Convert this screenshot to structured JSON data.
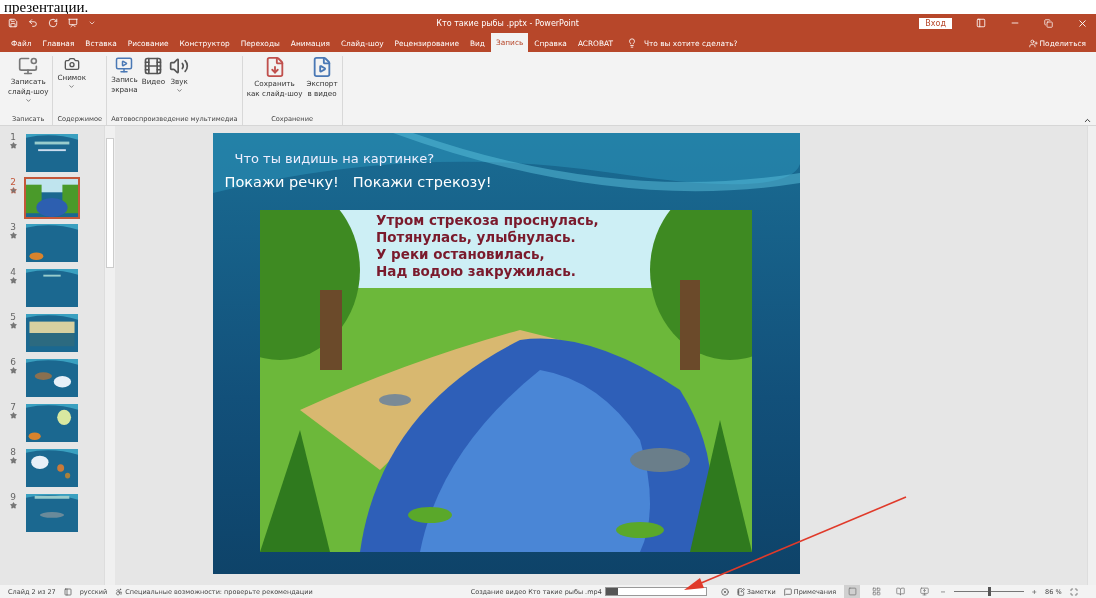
{
  "document_text": "презентации.",
  "window": {
    "title": "Кто такие  рыбы .pptx  -  PowerPoint",
    "sign_in": "Вход"
  },
  "tabs": [
    {
      "label": "Файл",
      "selected": false
    },
    {
      "label": "Главная",
      "selected": false
    },
    {
      "label": "Вставка",
      "selected": false
    },
    {
      "label": "Рисование",
      "selected": false
    },
    {
      "label": "Конструктор",
      "selected": false
    },
    {
      "label": "Переходы",
      "selected": false
    },
    {
      "label": "Анимация",
      "selected": false
    },
    {
      "label": "Слайд-шоу",
      "selected": false
    },
    {
      "label": "Рецензирование",
      "selected": false
    },
    {
      "label": "Вид",
      "selected": false
    },
    {
      "label": "Запись",
      "selected": true
    },
    {
      "label": "Справка",
      "selected": false
    },
    {
      "label": "ACROBAT",
      "selected": false
    }
  ],
  "tell_me": "Что вы хотите сделать?",
  "share": "Поделиться",
  "ribbon_groups": [
    {
      "label": "Записать",
      "buttons": [
        {
          "kind": "record",
          "lines": [
            "Записать",
            "слайд-шоу"
          ],
          "dropdown": true
        }
      ]
    },
    {
      "label": "Содержимое",
      "buttons": [
        {
          "kind": "camera",
          "lines": [
            "Снимок"
          ],
          "dropdown": true
        }
      ]
    },
    {
      "label": "Автовоспроизведение мультимедиа",
      "buttons": [
        {
          "kind": "screen",
          "lines": [
            "Запись",
            "экрана"
          ],
          "dropdown": false
        },
        {
          "kind": "video",
          "lines": [
            "Видео"
          ],
          "dropdown": false
        },
        {
          "kind": "sound",
          "lines": [
            "Звук"
          ],
          "dropdown": true
        }
      ]
    },
    {
      "label": "Сохранение",
      "buttons": [
        {
          "kind": "save",
          "lines": [
            "Сохранить",
            "как слайд-шоу"
          ],
          "dropdown": false
        },
        {
          "kind": "export",
          "lines": [
            "Экспорт",
            "в видео"
          ],
          "dropdown": false
        }
      ]
    }
  ],
  "slides": [
    {
      "number": "1",
      "selected": false
    },
    {
      "number": "2",
      "selected": true
    },
    {
      "number": "3",
      "selected": false
    },
    {
      "number": "4",
      "selected": false
    },
    {
      "number": "5",
      "selected": false
    },
    {
      "number": "6",
      "selected": false
    },
    {
      "number": "7",
      "selected": false
    },
    {
      "number": "8",
      "selected": false
    },
    {
      "number": "9",
      "selected": false
    }
  ],
  "slide": {
    "question": "Что ты видишь на картинке?",
    "prompts": [
      "Покажи речку!",
      "Покажи стрекозу!"
    ],
    "poem": [
      "Утром стрекоза проснулась,",
      "Потянулась, улыбнулась.",
      "У реки остановилась,",
      "Над водою  закружилась."
    ]
  },
  "status_bar": {
    "slide_info": "Слайд 2 из 27",
    "language": "русский",
    "accessibility": "Специальные возможности: проверьте рекомендации",
    "video_export": "Создание видео Кто такие  рыбы .mp4",
    "progress": {
      "level": 0.12
    },
    "notes": "Заметки",
    "comments": "Примечания",
    "views": [
      {
        "kind": "normal",
        "selected": true
      },
      {
        "kind": "sorter",
        "selected": false
      },
      {
        "kind": "reading",
        "selected": false
      },
      {
        "kind": "show",
        "selected": false
      }
    ],
    "zoom_minus": "−",
    "zoom_plus": "+",
    "zoom": {
      "level": 0.5
    },
    "zoom_value": "86 %"
  }
}
